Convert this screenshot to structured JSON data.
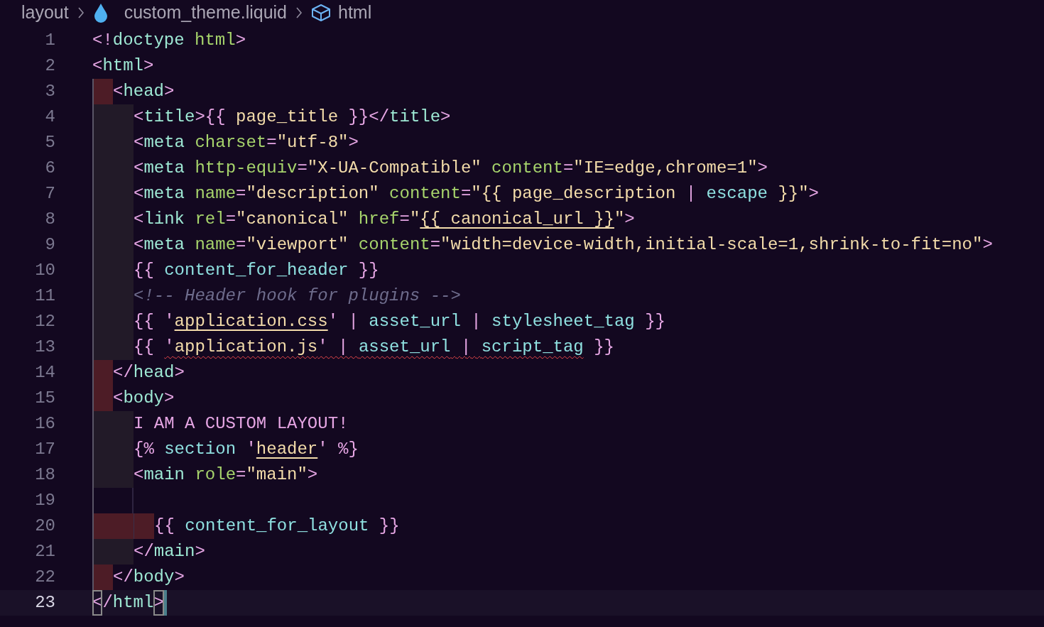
{
  "breadcrumb": [
    {
      "kind": "folder",
      "text": "layout"
    },
    {
      "kind": "liquid-file",
      "text": "custom_theme.liquid"
    },
    {
      "kind": "element",
      "text": "html"
    }
  ],
  "lines": [
    {
      "number": "1",
      "current": false,
      "tokens": [
        {
          "kind": "punct",
          "text": "<!"
        },
        {
          "kind": "tag",
          "text": "doctype"
        },
        {
          "kind": "attr",
          "text": " html"
        },
        {
          "kind": "punct",
          "text": ">"
        }
      ]
    },
    {
      "number": "2",
      "current": false,
      "tokens": [
        {
          "kind": "punct",
          "text": "<"
        },
        {
          "kind": "tag",
          "text": "html"
        },
        {
          "kind": "punct",
          "text": ">"
        }
      ]
    },
    {
      "number": "3",
      "current": false,
      "indent": [
        {
          "kind": "error"
        }
      ],
      "tokens": [
        {
          "kind": "punct",
          "text": "<"
        },
        {
          "kind": "tag",
          "text": "head"
        },
        {
          "kind": "punct",
          "text": ">"
        }
      ]
    },
    {
      "number": "4",
      "current": false,
      "indent": [
        {
          "kind": "normal"
        },
        {
          "kind": "normal"
        }
      ],
      "tokens": [
        {
          "kind": "punct",
          "text": "<"
        },
        {
          "kind": "tag",
          "text": "title"
        },
        {
          "kind": "punct",
          "text": ">{{"
        },
        {
          "kind": "string",
          "text": " page_title "
        },
        {
          "kind": "punct",
          "text": "}}</"
        },
        {
          "kind": "tag",
          "text": "title"
        },
        {
          "kind": "punct",
          "text": ">"
        }
      ]
    },
    {
      "number": "5",
      "current": false,
      "indent": [
        {
          "kind": "normal"
        },
        {
          "kind": "normal"
        }
      ],
      "tokens": [
        {
          "kind": "punct",
          "text": "<"
        },
        {
          "kind": "tag",
          "text": "meta"
        },
        {
          "kind": "attr",
          "text": " charset"
        },
        {
          "kind": "punct",
          "text": "="
        },
        {
          "kind": "string",
          "text": "\"utf-8\""
        },
        {
          "kind": "punct",
          "text": ">"
        }
      ]
    },
    {
      "number": "6",
      "current": false,
      "indent": [
        {
          "kind": "normal"
        },
        {
          "kind": "normal"
        }
      ],
      "tokens": [
        {
          "kind": "punct",
          "text": "<"
        },
        {
          "kind": "tag",
          "text": "meta"
        },
        {
          "kind": "attr",
          "text": " http-equiv"
        },
        {
          "kind": "punct",
          "text": "="
        },
        {
          "kind": "string",
          "text": "\"X-UA-Compatible\""
        },
        {
          "kind": "attr",
          "text": " content"
        },
        {
          "kind": "punct",
          "text": "="
        },
        {
          "kind": "string",
          "text": "\"IE=edge,chrome=1\""
        },
        {
          "kind": "punct",
          "text": ">"
        }
      ]
    },
    {
      "number": "7",
      "current": false,
      "indent": [
        {
          "kind": "normal"
        },
        {
          "kind": "normal"
        }
      ],
      "tokens": [
        {
          "kind": "punct",
          "text": "<"
        },
        {
          "kind": "tag",
          "text": "meta"
        },
        {
          "kind": "attr",
          "text": " name"
        },
        {
          "kind": "punct",
          "text": "="
        },
        {
          "kind": "string",
          "text": "\"description\""
        },
        {
          "kind": "attr",
          "text": " content"
        },
        {
          "kind": "punct",
          "text": "="
        },
        {
          "kind": "string",
          "text": "\"{{ page_description "
        },
        {
          "kind": "punct",
          "text": "|"
        },
        {
          "kind": "liquid",
          "text": " escape "
        },
        {
          "kind": "string",
          "text": "}}\""
        },
        {
          "kind": "punct",
          "text": ">"
        }
      ]
    },
    {
      "number": "8",
      "current": false,
      "indent": [
        {
          "kind": "normal"
        },
        {
          "kind": "normal"
        }
      ],
      "tokens": [
        {
          "kind": "punct",
          "text": "<"
        },
        {
          "kind": "tag",
          "text": "link"
        },
        {
          "kind": "attr",
          "text": " rel"
        },
        {
          "kind": "punct",
          "text": "="
        },
        {
          "kind": "string",
          "text": "\"canonical\""
        },
        {
          "kind": "attr",
          "text": " href"
        },
        {
          "kind": "punct",
          "text": "="
        },
        {
          "kind": "string",
          "text": "\""
        },
        {
          "kind": "string",
          "text": "{{ canonical_url }}",
          "underlined": true
        },
        {
          "kind": "string",
          "text": "\""
        },
        {
          "kind": "punct",
          "text": ">"
        }
      ]
    },
    {
      "number": "9",
      "current": false,
      "indent": [
        {
          "kind": "normal"
        },
        {
          "kind": "normal"
        }
      ],
      "tokens": [
        {
          "kind": "punct",
          "text": "<"
        },
        {
          "kind": "tag",
          "text": "meta"
        },
        {
          "kind": "attr",
          "text": " name"
        },
        {
          "kind": "punct",
          "text": "="
        },
        {
          "kind": "string",
          "text": "\"viewport\""
        },
        {
          "kind": "attr",
          "text": " content"
        },
        {
          "kind": "punct",
          "text": "="
        },
        {
          "kind": "string",
          "text": "\"width=device-width,initial-scale=1,shrink-to-fit=no\""
        },
        {
          "kind": "punct",
          "text": ">"
        }
      ]
    },
    {
      "number": "10",
      "current": false,
      "indent": [
        {
          "kind": "normal"
        },
        {
          "kind": "normal"
        }
      ],
      "tokens": [
        {
          "kind": "punct",
          "text": "{{"
        },
        {
          "kind": "liquid",
          "text": " content_for_header "
        },
        {
          "kind": "punct",
          "text": "}}"
        }
      ]
    },
    {
      "number": "11",
      "current": false,
      "indent": [
        {
          "kind": "normal"
        },
        {
          "kind": "normal"
        }
      ],
      "tokens": [
        {
          "kind": "comment",
          "text": "<!-- Header hook for plugins -->"
        }
      ]
    },
    {
      "number": "12",
      "current": false,
      "indent": [
        {
          "kind": "normal"
        },
        {
          "kind": "normal"
        }
      ],
      "tokens": [
        {
          "kind": "punct",
          "text": "{{ '"
        },
        {
          "kind": "string",
          "text": "application.css",
          "underlined": true
        },
        {
          "kind": "punct",
          "text": "' | "
        },
        {
          "kind": "liquid",
          "text": "asset_url"
        },
        {
          "kind": "punct",
          "text": " | "
        },
        {
          "kind": "liquid",
          "text": "stylesheet_tag"
        },
        {
          "kind": "punct",
          "text": " }}"
        }
      ]
    },
    {
      "number": "13",
      "current": false,
      "indent": [
        {
          "kind": "normal"
        },
        {
          "kind": "normal"
        }
      ],
      "tokens": [
        {
          "kind": "punct",
          "text": "{{ "
        },
        {
          "kind": "punct",
          "text": "'",
          "error": true
        },
        {
          "kind": "string",
          "text": "application.js",
          "error": true
        },
        {
          "kind": "punct",
          "text": "' | ",
          "error": true
        },
        {
          "kind": "liquid",
          "text": "asset_url",
          "error": true
        },
        {
          "kind": "punct",
          "text": " | ",
          "error": true
        },
        {
          "kind": "liquid",
          "text": "script_tag",
          "error": true
        },
        {
          "kind": "punct",
          "text": " }}"
        }
      ]
    },
    {
      "number": "14",
      "current": false,
      "indent": [
        {
          "kind": "error"
        }
      ],
      "tokens": [
        {
          "kind": "punct",
          "text": "</"
        },
        {
          "kind": "tag",
          "text": "head"
        },
        {
          "kind": "punct",
          "text": ">"
        }
      ]
    },
    {
      "number": "15",
      "current": false,
      "indent": [
        {
          "kind": "error"
        }
      ],
      "tokens": [
        {
          "kind": "punct",
          "text": "<"
        },
        {
          "kind": "tag",
          "text": "body"
        },
        {
          "kind": "punct",
          "text": ">"
        }
      ]
    },
    {
      "number": "16",
      "current": false,
      "indent": [
        {
          "kind": "normal"
        },
        {
          "kind": "normal"
        }
      ],
      "tokens": [
        {
          "kind": "text",
          "text": "I AM A CUSTOM LAYOUT!"
        }
      ]
    },
    {
      "number": "17",
      "current": false,
      "indent": [
        {
          "kind": "normal"
        },
        {
          "kind": "normal"
        }
      ],
      "tokens": [
        {
          "kind": "punct",
          "text": "{%"
        },
        {
          "kind": "liquid",
          "text": " section "
        },
        {
          "kind": "punct",
          "text": "'"
        },
        {
          "kind": "string",
          "text": "header",
          "underlined": true
        },
        {
          "kind": "punct",
          "text": "' %}"
        }
      ]
    },
    {
      "number": "18",
      "current": false,
      "indent": [
        {
          "kind": "normal"
        },
        {
          "kind": "normal"
        }
      ],
      "tokens": [
        {
          "kind": "punct",
          "text": "<"
        },
        {
          "kind": "tag",
          "text": "main"
        },
        {
          "kind": "attr",
          "text": " role"
        },
        {
          "kind": "punct",
          "text": "="
        },
        {
          "kind": "string",
          "text": "\"main\""
        },
        {
          "kind": "punct",
          "text": ">"
        }
      ]
    },
    {
      "number": "19",
      "current": false,
      "indent": [
        {
          "kind": "blank"
        },
        {
          "kind": "blank"
        }
      ]
    },
    {
      "number": "20",
      "current": false,
      "indent": [
        {
          "kind": "error"
        },
        {
          "kind": "error"
        },
        {
          "kind": "error"
        }
      ],
      "tokens": [
        {
          "kind": "punct",
          "text": "{{"
        },
        {
          "kind": "liquid",
          "text": " content_for_layout "
        },
        {
          "kind": "punct",
          "text": "}}"
        }
      ]
    },
    {
      "number": "21",
      "current": false,
      "indent": [
        {
          "kind": "normal"
        },
        {
          "kind": "normal"
        }
      ],
      "tokens": [
        {
          "kind": "punct",
          "text": "</"
        },
        {
          "kind": "tag",
          "text": "main"
        },
        {
          "kind": "punct",
          "text": ">"
        }
      ]
    },
    {
      "number": "22",
      "current": false,
      "indent": [
        {
          "kind": "error"
        }
      ],
      "tokens": [
        {
          "kind": "punct",
          "text": "</"
        },
        {
          "kind": "tag",
          "text": "body"
        },
        {
          "kind": "punct",
          "text": ">"
        }
      ]
    },
    {
      "number": "23",
      "current": true,
      "tokens": [
        {
          "kind": "punct",
          "text": "<",
          "matched": true
        },
        {
          "kind": "punct",
          "text": "/"
        },
        {
          "kind": "tag",
          "text": "html"
        },
        {
          "kind": "punct",
          "text": ">",
          "matched": true
        }
      ]
    }
  ]
}
